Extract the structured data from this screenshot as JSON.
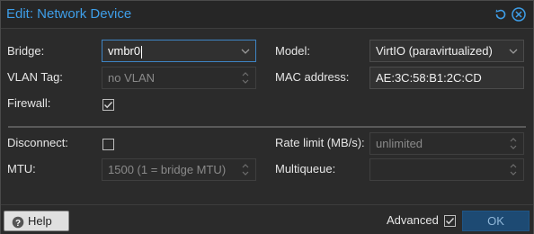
{
  "window": {
    "title": "Edit: Network Device",
    "accent": "#3e9ee8"
  },
  "tools": {
    "reset_icon": "reset-icon",
    "close_icon": "close-icon"
  },
  "form": {
    "bridge": {
      "label": "Bridge:",
      "value": "vmbr0"
    },
    "vlan": {
      "label": "VLAN Tag:",
      "placeholder": "no VLAN"
    },
    "firewall": {
      "label": "Firewall:",
      "checked": true
    },
    "model": {
      "label": "Model:",
      "value": "VirtIO (paravirtualized)"
    },
    "mac": {
      "label": "MAC address:",
      "value": "AE:3C:58:B1:2C:CD"
    },
    "disconnect": {
      "label": "Disconnect:",
      "checked": false
    },
    "mtu": {
      "label": "MTU:",
      "placeholder": "1500 (1 = bridge MTU)"
    },
    "rate_limit": {
      "label": "Rate limit (MB/s):",
      "placeholder": "unlimited"
    },
    "multiqueue": {
      "label": "Multiqueue:",
      "value": ""
    }
  },
  "footer": {
    "help_label": "Help",
    "advanced_label": "Advanced",
    "advanced_checked": true,
    "ok_label": "OK"
  }
}
